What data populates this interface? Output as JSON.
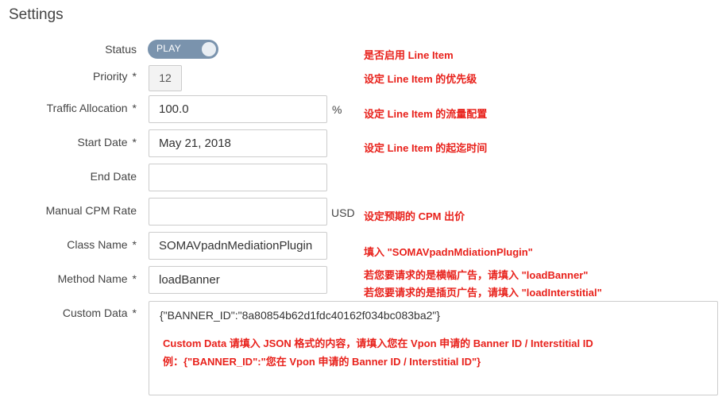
{
  "page": {
    "title": "Settings"
  },
  "fields": {
    "status": {
      "label": "Status",
      "toggle_text": "PLAY"
    },
    "priority": {
      "label": "Priority",
      "required": "*",
      "value": "12"
    },
    "traffic_allocation": {
      "label": "Traffic Allocation",
      "required": "*",
      "value": "100.0",
      "unit": "%"
    },
    "start_date": {
      "label": "Start Date",
      "required": "*",
      "value": "May 21, 2018"
    },
    "end_date": {
      "label": "End Date",
      "value": ""
    },
    "manual_cpm_rate": {
      "label": "Manual CPM Rate",
      "value": "",
      "unit": "USD"
    },
    "class_name": {
      "label": "Class Name",
      "required": "*",
      "value": "SOMAVpadnMediationPlugin"
    },
    "method_name": {
      "label": "Method Name",
      "required": "*",
      "value": "loadBanner"
    },
    "custom_data": {
      "label": "Custom Data",
      "required": "*",
      "value": "{\"BANNER_ID\":\"8a80854b62d1fdc40162f034bc083ba2\"}"
    }
  },
  "annotations": {
    "status": "是否启用 Line Item",
    "priority": "设定 Line Item 的优先级",
    "traffic": "设定 Line Item 的流量配置",
    "start_date": "设定 Line Item 的起迄时间",
    "cpm": "设定预期的 CPM 出价",
    "class_name": "填入 \"SOMAVpadnMdiationPlugin\"",
    "method_banner": "若您要请求的是横幅广告，请填入 \"loadBanner\"",
    "method_interstitial": "若您要请求的是插页广告，请填入 \"loadInterstitial\"",
    "custom_data_line1": "Custom Data 请填入 JSON 格式的内容，请填入您在 Vpon 申请的 Banner ID / Interstitial ID",
    "custom_data_line2": "例：{\"BANNER_ID\":\"您在 Vpon 申请的 Banner ID / Interstitial ID\"}"
  },
  "colors": {
    "toggle_bg": "#7a93ad",
    "annotation": "#e8211b"
  }
}
